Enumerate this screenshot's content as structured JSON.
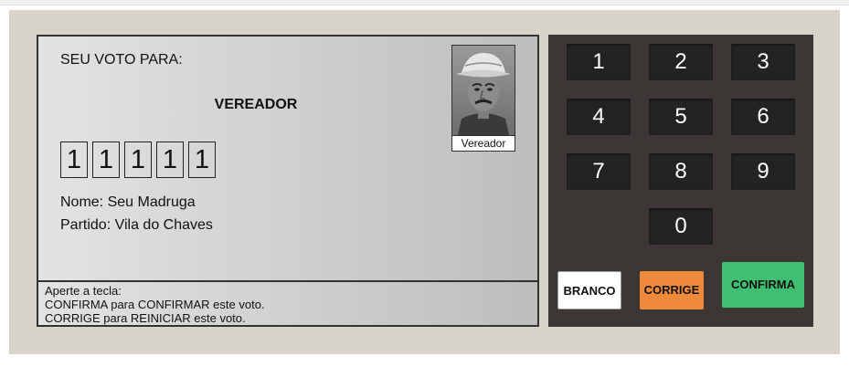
{
  "screen": {
    "vote_for": "SEU VOTO PARA:",
    "office": "VEREADOR",
    "digits": [
      "1",
      "1",
      "1",
      "1",
      "1"
    ],
    "name_line": "Nome: Seu Madruga",
    "party_line": "Partido: Vila do Chaves",
    "photo_caption": "Vereador",
    "instructions": [
      "Aperte a tecla:",
      "CONFIRMA para CONFIRMAR este voto.",
      "CORRIGE para REINICIAR este voto."
    ]
  },
  "keypad": {
    "keys": [
      "1",
      "2",
      "3",
      "4",
      "5",
      "6",
      "7",
      "8",
      "9",
      "0"
    ],
    "branco": "BRANCO",
    "corrige": "CORRIGE",
    "confirma": "CONFIRMA"
  },
  "colors": {
    "urna_body": "#d9d4c9",
    "keypad_body": "#3c3634",
    "key": "#232323",
    "branco": "#ffffff",
    "corrige": "#ef8a3c",
    "confirma": "#3fbf72"
  }
}
